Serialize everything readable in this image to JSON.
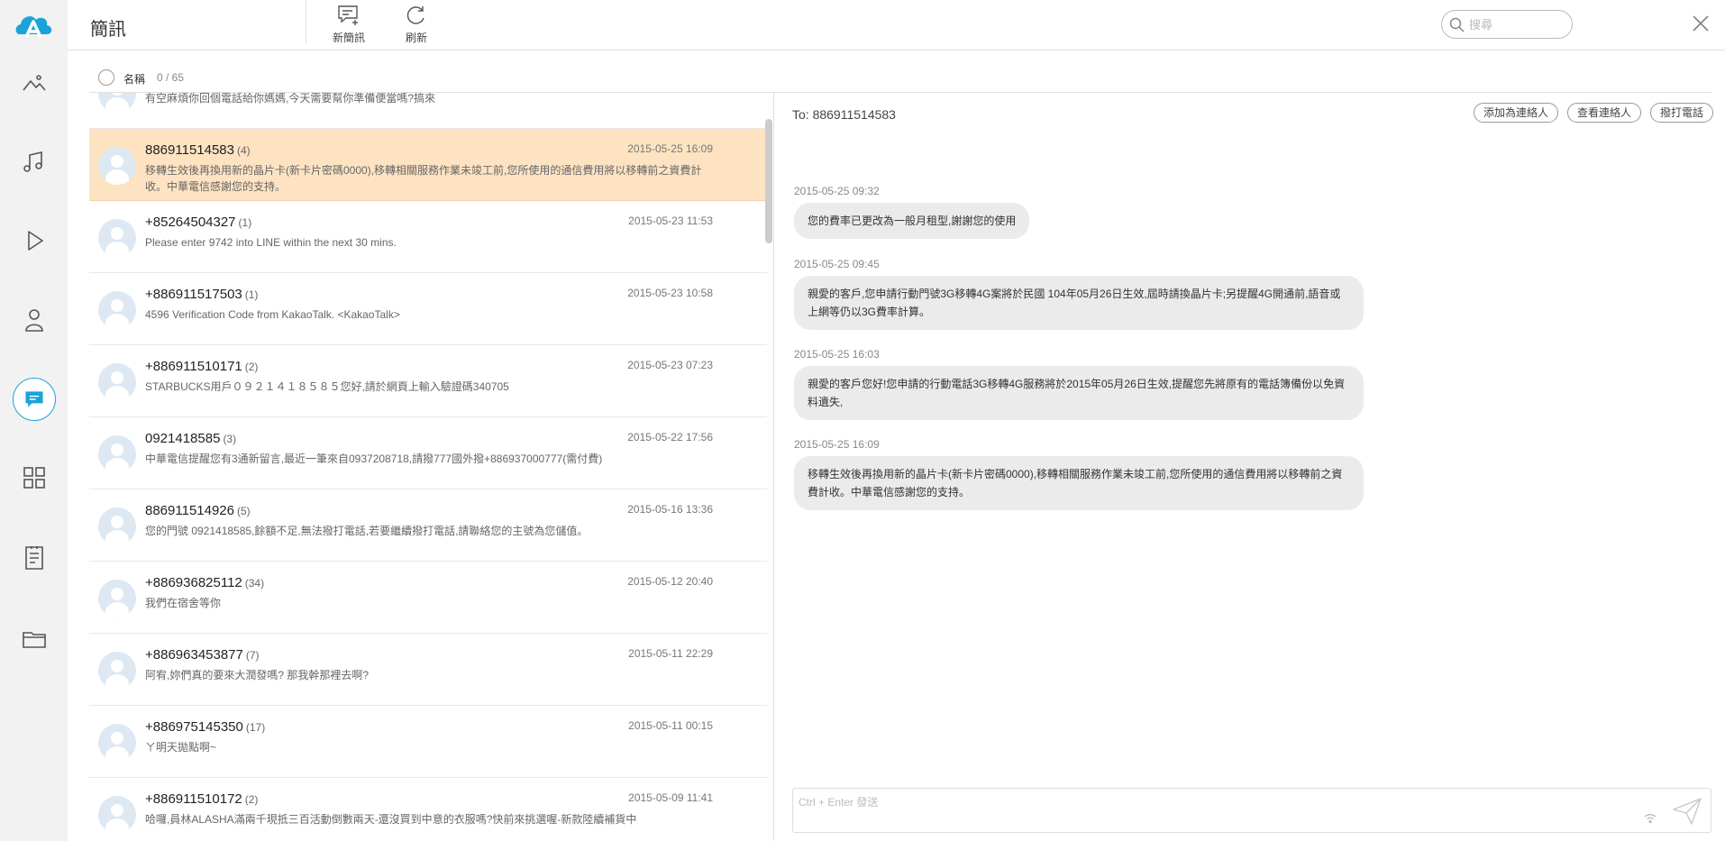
{
  "rail": {
    "items": [
      {
        "name": "photos-icon"
      },
      {
        "name": "music-icon"
      },
      {
        "name": "video-icon"
      },
      {
        "name": "contacts-icon"
      },
      {
        "name": "messages-icon"
      },
      {
        "name": "apps-icon"
      },
      {
        "name": "notes-icon"
      },
      {
        "name": "files-icon"
      }
    ],
    "active": "messages-icon",
    "accent": "#1aa3d9"
  },
  "header": {
    "title": "簡訊",
    "new_label": "新簡訊",
    "refresh_label": "刷新",
    "search_placeholder": "搜尋"
  },
  "list_header": {
    "label": "名稱",
    "count": "0 / 65"
  },
  "threads": [
    {
      "name": "",
      "count": "",
      "time": "",
      "preview": "有空麻煩你回個電話給你媽媽,今天需要幫你準備便當嗎?搞來"
    },
    {
      "name": "886911514583",
      "count": "(4)",
      "time": "2015-05-25 16:09",
      "preview": "移轉生效後再換用新的晶片卡(新卡片密碼0000),移轉相關服務作業未竣工前,您所使用的通信費用將以移轉前之資費計收。中華電信感謝您的支持。",
      "selected": true
    },
    {
      "name": "+85264504327",
      "count": "(1)",
      "time": "2015-05-23 11:53",
      "preview": "Please enter 9742 into LINE within the next 30 mins."
    },
    {
      "name": "+886911517503",
      "count": "(1)",
      "time": "2015-05-23 10:58",
      "preview": "4596 Verification Code from KakaoTalk. <KakaoTalk>"
    },
    {
      "name": "+886911510171",
      "count": "(2)",
      "time": "2015-05-23 07:23",
      "preview": "STARBUCKS用戶０９２１４１８５８５您好,請於網頁上輸入驗證碼340705"
    },
    {
      "name": "0921418585",
      "count": "(3)",
      "time": "2015-05-22 17:56",
      "preview": "中華電信提醒您有3通新留言,最近一筆來自0937208718,請撥777國外撥+886937000777(需付費)"
    },
    {
      "name": "886911514926",
      "count": "(5)",
      "time": "2015-05-16 13:36",
      "preview": "您的門號 0921418585,餘額不足,無法撥打電話,若要繼續撥打電話,請聯絡您的主號為您儲值。"
    },
    {
      "name": "+886936825112",
      "count": "(34)",
      "time": "2015-05-12 20:40",
      "preview": "我們在宿舍等你"
    },
    {
      "name": "+886963453877",
      "count": "(7)",
      "time": "2015-05-11 22:29",
      "preview": "阿宥,妳們真的要來大潤發嗎? 那我幹那裡去啊?"
    },
    {
      "name": "+886975145350",
      "count": "(17)",
      "time": "2015-05-11 00:15",
      "preview": "ㄚ明天拋點啊~"
    },
    {
      "name": "+886911510172",
      "count": "(2)",
      "time": "2015-05-09 11:41",
      "preview": "哈囉,員林ALASHA滿兩千現抵三百活動倒數兩天-還沒買到中意的衣服嗎?快前來挑選喔-新款陸續補貨中"
    }
  ],
  "conversation": {
    "to": "To: 886911514583",
    "add_contact": "添加為連絡人",
    "view_contact": "查看連絡人",
    "call": "撥打電話",
    "messages": [
      {
        "time": "2015-05-25 09:32",
        "text": "您的費率已更改為一般月租型,謝謝您的使用"
      },
      {
        "time": "2015-05-25 09:45",
        "text": "親愛的客戶,您申請行動門號3G移轉4G案將於民國 104年05月26日生效,屆時請換晶片卡;另提醒4G開通前,語音或上網等仍以3G費率計算。"
      },
      {
        "time": "2015-05-25 16:03",
        "text": "親愛的客戶您好!您申請的行動電話3G移轉4G服務將於2015年05月26日生效,提醒您先將原有的電話簿備份以免資料遺失,"
      },
      {
        "time": "2015-05-25 16:09",
        "text": "移轉生效後再換用新的晶片卡(新卡片密碼0000),移轉相關服務作業未竣工前,您所使用的通信費用將以移轉前之資費計收。中華電信感謝您的支持。"
      }
    ],
    "compose_placeholder": "Ctrl + Enter 發送"
  }
}
